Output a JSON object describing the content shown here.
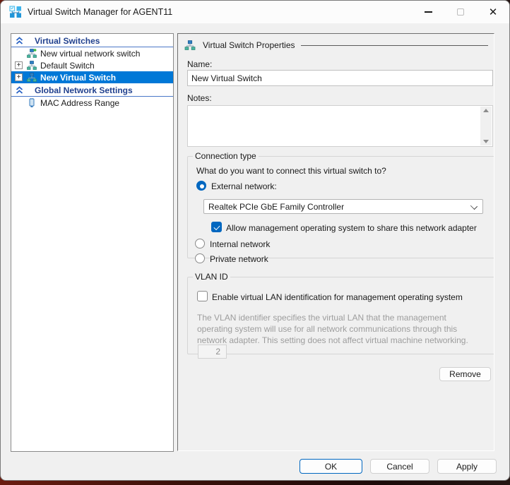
{
  "titlebar": {
    "title": "Virtual Switch Manager for AGENT11"
  },
  "tree": {
    "items": [
      {
        "label": "Virtual Switches",
        "type": "header",
        "icon": "double-chevron-up-icon"
      },
      {
        "label": "New virtual network switch",
        "type": "item",
        "icon": "new-virtual-switch-icon"
      },
      {
        "label": "Default Switch",
        "type": "item",
        "icon": "virtual-switch-icon",
        "expander": "+"
      },
      {
        "label": "New Virtual Switch",
        "type": "item",
        "icon": "virtual-switch-icon",
        "expander": "+",
        "selected": true
      },
      {
        "label": "Global Network Settings",
        "type": "header",
        "icon": "double-chevron-up-icon"
      },
      {
        "label": "MAC Address Range",
        "type": "item",
        "icon": "mac-address-icon"
      }
    ]
  },
  "properties": {
    "section_title": "Virtual Switch Properties",
    "name_label": "Name:",
    "name_value": "New Virtual Switch",
    "notes_label": "Notes:",
    "notes_value": "",
    "connection": {
      "legend": "Connection type",
      "question": "What do you want to connect this virtual switch to?",
      "external_label": "External network:",
      "external_selected": true,
      "adapter_value": "Realtek PCIe GbE Family Controller",
      "share_label": "Allow management operating system to share this network adapter",
      "share_checked": true,
      "internal_label": "Internal network",
      "internal_selected": false,
      "private_label": "Private network",
      "private_selected": false
    },
    "vlan": {
      "legend": "VLAN ID",
      "enable_label": "Enable virtual LAN identification for management operating system",
      "enable_checked": false,
      "description": "The VLAN identifier specifies the virtual LAN that the management operating system will use for all network communications through this network adapter. This setting does not affect virtual machine networking.",
      "vlan_value": "2"
    },
    "remove_label": "Remove"
  },
  "footer": {
    "ok_label": "OK",
    "cancel_label": "Cancel",
    "apply_label": "Apply"
  },
  "colors": {
    "selection_blue": "#0078d7",
    "accent_blue": "#0067c0",
    "tree_header_text": "#21418e",
    "disabled_text": "#9d9d9d"
  }
}
